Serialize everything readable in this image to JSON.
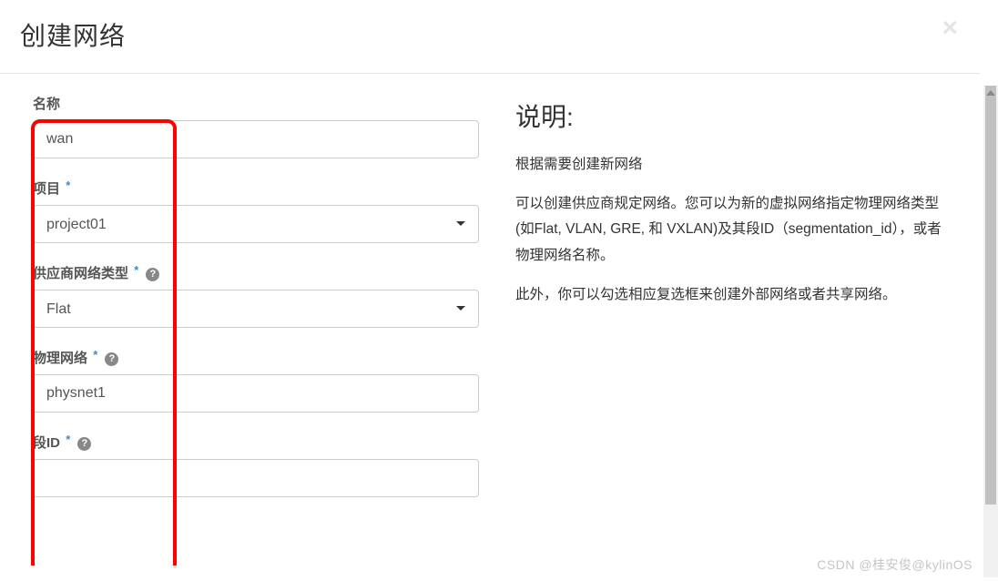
{
  "modal": {
    "title": "创建网络",
    "close_glyph": "×"
  },
  "form": {
    "name": {
      "label": "名称",
      "value": "wan"
    },
    "project": {
      "label": "项目",
      "value": "project01"
    },
    "provider_type": {
      "label": "供应商网络类型",
      "value": "Flat"
    },
    "physical_network": {
      "label": "物理网络",
      "value": "physnet1"
    },
    "segment_id": {
      "label": "段ID",
      "value": ""
    }
  },
  "help": {
    "glyph": "?"
  },
  "description": {
    "title": "说明:",
    "p1": "根据需要创建新网络",
    "p2": "可以创建供应商规定网络。您可以为新的虚拟网络指定物理网络类型(如Flat, VLAN, GRE, 和 VXLAN)及其段ID（segmentation_id），或者物理网络名称。",
    "p3": "此外，你可以勾选相应复选框来创建外部网络或者共享网络。"
  },
  "watermark": "CSDN @桂安俊@kylinOS"
}
